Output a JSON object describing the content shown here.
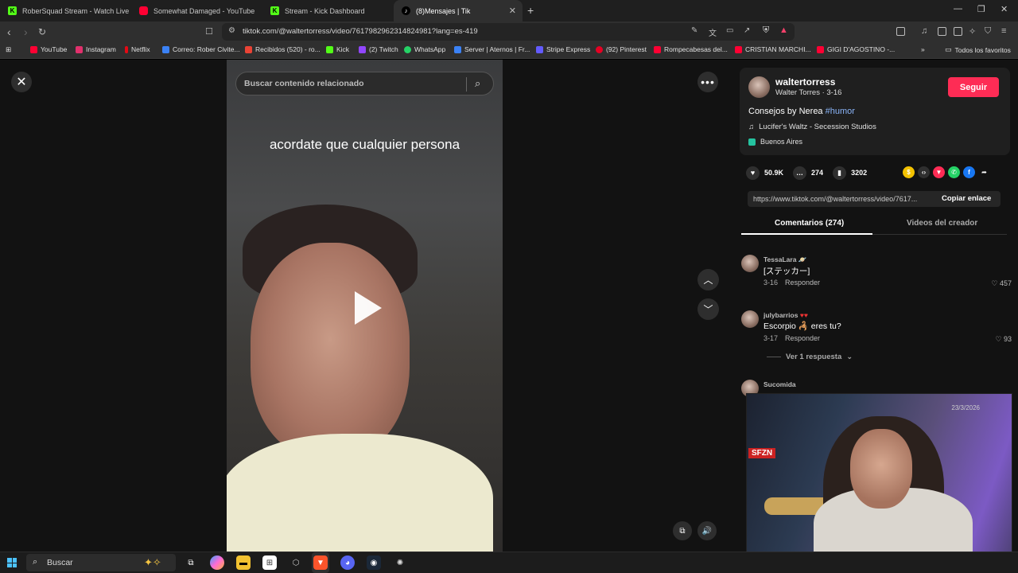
{
  "browser": {
    "tabs": [
      {
        "title": "RoberSquad Stream - Watch Live",
        "icon": "kick-icon"
      },
      {
        "title": "Somewhat Damaged - YouTube",
        "icon": "youtube-icon"
      },
      {
        "title": "Stream - Kick Dashboard",
        "icon": "kick-icon"
      },
      {
        "title": "(8)Mensajes | Tik",
        "icon": "tiktok-icon",
        "active": true
      }
    ],
    "url": "tiktok.com/@waltertorress/video/7617982962314824981?lang=es-419",
    "bookmarks": [
      {
        "label": "YouTube",
        "color": "#ff0033"
      },
      {
        "label": "Instagram",
        "color": "#e1306c"
      },
      {
        "label": "Netflix",
        "color": "#e50914"
      },
      {
        "label": "Correo: Rober Civite...",
        "color": "#3b82f6"
      },
      {
        "label": "Recibidos (520) - ro...",
        "color": "#ea4335"
      },
      {
        "label": "Kick",
        "color": "#53fc18"
      },
      {
        "label": "(2) Twitch",
        "color": "#9146ff"
      },
      {
        "label": "WhatsApp",
        "color": "#25d366"
      },
      {
        "label": "Server | Aternos | Fr...",
        "color": "#3b82f6"
      },
      {
        "label": "Stripe Express",
        "color": "#635bff"
      },
      {
        "label": "(92) Pinterest",
        "color": "#e60023"
      },
      {
        "label": "Rompecabesas del...",
        "color": "#ff0033"
      },
      {
        "label": "CRISTIAN MARCHI...",
        "color": "#ff0033"
      },
      {
        "label": "GIGI D'AGOSTINO -...",
        "color": "#ff0033"
      }
    ],
    "all_bookmarks": "Todos los favoritos"
  },
  "player": {
    "search_placeholder": "Buscar contenido relacionado",
    "caption": "acordate que cualquier persona"
  },
  "creator": {
    "username": "waltertorress",
    "subtitle": "Walter Torres · 3-16",
    "follow_label": "Seguir",
    "description": "Consejos by Nerea ",
    "hashtag": "#humor",
    "music": "Lucifer's Waltz - Secession Studios",
    "location": "Buenos Aires"
  },
  "stats": {
    "likes": "50.9K",
    "comments": "274",
    "saves": "3202"
  },
  "share": {
    "link": "https://www.tiktok.com/@waltertorress/video/7617...",
    "copy_label": "Copiar enlace"
  },
  "panel_tabs": {
    "comments": "Comentarios (274)",
    "creator_videos": "Videos del creador"
  },
  "comments": [
    {
      "user": "TessaLara",
      "text": "[ステッカー]",
      "date": "3-16",
      "reply": "Responder",
      "likes": "457"
    },
    {
      "user": "julybarrios",
      "text": "Escorpio 🦂 eres tu?",
      "date": "3-17",
      "reply": "Responder",
      "likes": "93",
      "more": "Ver 1 respuesta"
    },
    {
      "user": "Sucomida",
      "text": "",
      "date": "",
      "reply": "",
      "likes": ""
    }
  ],
  "taskbar": {
    "search_label": "Buscar",
    "date": "23/3/2026"
  }
}
